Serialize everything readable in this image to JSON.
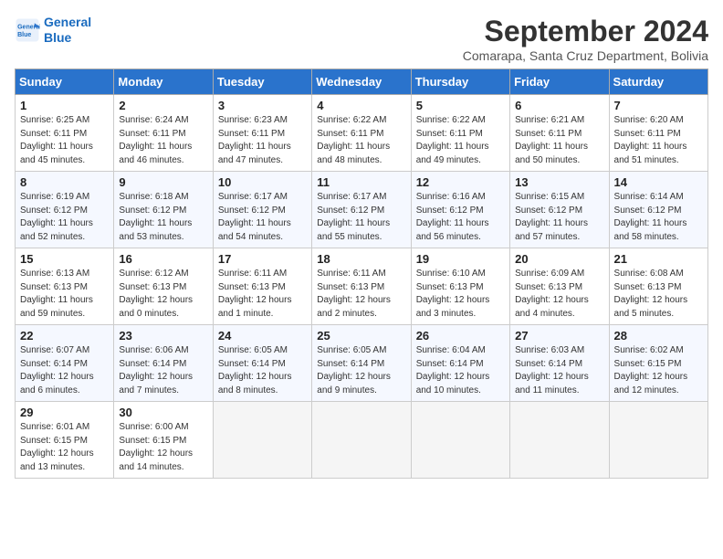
{
  "header": {
    "logo_line1": "General",
    "logo_line2": "Blue",
    "month": "September 2024",
    "location": "Comarapa, Santa Cruz Department, Bolivia"
  },
  "weekdays": [
    "Sunday",
    "Monday",
    "Tuesday",
    "Wednesday",
    "Thursday",
    "Friday",
    "Saturday"
  ],
  "weeks": [
    [
      {
        "day": "1",
        "sunrise": "6:25 AM",
        "sunset": "6:11 PM",
        "daylight": "11 hours and 45 minutes."
      },
      {
        "day": "2",
        "sunrise": "6:24 AM",
        "sunset": "6:11 PM",
        "daylight": "11 hours and 46 minutes."
      },
      {
        "day": "3",
        "sunrise": "6:23 AM",
        "sunset": "6:11 PM",
        "daylight": "11 hours and 47 minutes."
      },
      {
        "day": "4",
        "sunrise": "6:22 AM",
        "sunset": "6:11 PM",
        "daylight": "11 hours and 48 minutes."
      },
      {
        "day": "5",
        "sunrise": "6:22 AM",
        "sunset": "6:11 PM",
        "daylight": "11 hours and 49 minutes."
      },
      {
        "day": "6",
        "sunrise": "6:21 AM",
        "sunset": "6:11 PM",
        "daylight": "11 hours and 50 minutes."
      },
      {
        "day": "7",
        "sunrise": "6:20 AM",
        "sunset": "6:11 PM",
        "daylight": "11 hours and 51 minutes."
      }
    ],
    [
      {
        "day": "8",
        "sunrise": "6:19 AM",
        "sunset": "6:12 PM",
        "daylight": "11 hours and 52 minutes."
      },
      {
        "day": "9",
        "sunrise": "6:18 AM",
        "sunset": "6:12 PM",
        "daylight": "11 hours and 53 minutes."
      },
      {
        "day": "10",
        "sunrise": "6:17 AM",
        "sunset": "6:12 PM",
        "daylight": "11 hours and 54 minutes."
      },
      {
        "day": "11",
        "sunrise": "6:17 AM",
        "sunset": "6:12 PM",
        "daylight": "11 hours and 55 minutes."
      },
      {
        "day": "12",
        "sunrise": "6:16 AM",
        "sunset": "6:12 PM",
        "daylight": "11 hours and 56 minutes."
      },
      {
        "day": "13",
        "sunrise": "6:15 AM",
        "sunset": "6:12 PM",
        "daylight": "11 hours and 57 minutes."
      },
      {
        "day": "14",
        "sunrise": "6:14 AM",
        "sunset": "6:12 PM",
        "daylight": "11 hours and 58 minutes."
      }
    ],
    [
      {
        "day": "15",
        "sunrise": "6:13 AM",
        "sunset": "6:13 PM",
        "daylight": "11 hours and 59 minutes."
      },
      {
        "day": "16",
        "sunrise": "6:12 AM",
        "sunset": "6:13 PM",
        "daylight": "12 hours and 0 minutes."
      },
      {
        "day": "17",
        "sunrise": "6:11 AM",
        "sunset": "6:13 PM",
        "daylight": "12 hours and 1 minute."
      },
      {
        "day": "18",
        "sunrise": "6:11 AM",
        "sunset": "6:13 PM",
        "daylight": "12 hours and 2 minutes."
      },
      {
        "day": "19",
        "sunrise": "6:10 AM",
        "sunset": "6:13 PM",
        "daylight": "12 hours and 3 minutes."
      },
      {
        "day": "20",
        "sunrise": "6:09 AM",
        "sunset": "6:13 PM",
        "daylight": "12 hours and 4 minutes."
      },
      {
        "day": "21",
        "sunrise": "6:08 AM",
        "sunset": "6:13 PM",
        "daylight": "12 hours and 5 minutes."
      }
    ],
    [
      {
        "day": "22",
        "sunrise": "6:07 AM",
        "sunset": "6:14 PM",
        "daylight": "12 hours and 6 minutes."
      },
      {
        "day": "23",
        "sunrise": "6:06 AM",
        "sunset": "6:14 PM",
        "daylight": "12 hours and 7 minutes."
      },
      {
        "day": "24",
        "sunrise": "6:05 AM",
        "sunset": "6:14 PM",
        "daylight": "12 hours and 8 minutes."
      },
      {
        "day": "25",
        "sunrise": "6:05 AM",
        "sunset": "6:14 PM",
        "daylight": "12 hours and 9 minutes."
      },
      {
        "day": "26",
        "sunrise": "6:04 AM",
        "sunset": "6:14 PM",
        "daylight": "12 hours and 10 minutes."
      },
      {
        "day": "27",
        "sunrise": "6:03 AM",
        "sunset": "6:14 PM",
        "daylight": "12 hours and 11 minutes."
      },
      {
        "day": "28",
        "sunrise": "6:02 AM",
        "sunset": "6:15 PM",
        "daylight": "12 hours and 12 minutes."
      }
    ],
    [
      {
        "day": "29",
        "sunrise": "6:01 AM",
        "sunset": "6:15 PM",
        "daylight": "12 hours and 13 minutes."
      },
      {
        "day": "30",
        "sunrise": "6:00 AM",
        "sunset": "6:15 PM",
        "daylight": "12 hours and 14 minutes."
      },
      null,
      null,
      null,
      null,
      null
    ]
  ]
}
